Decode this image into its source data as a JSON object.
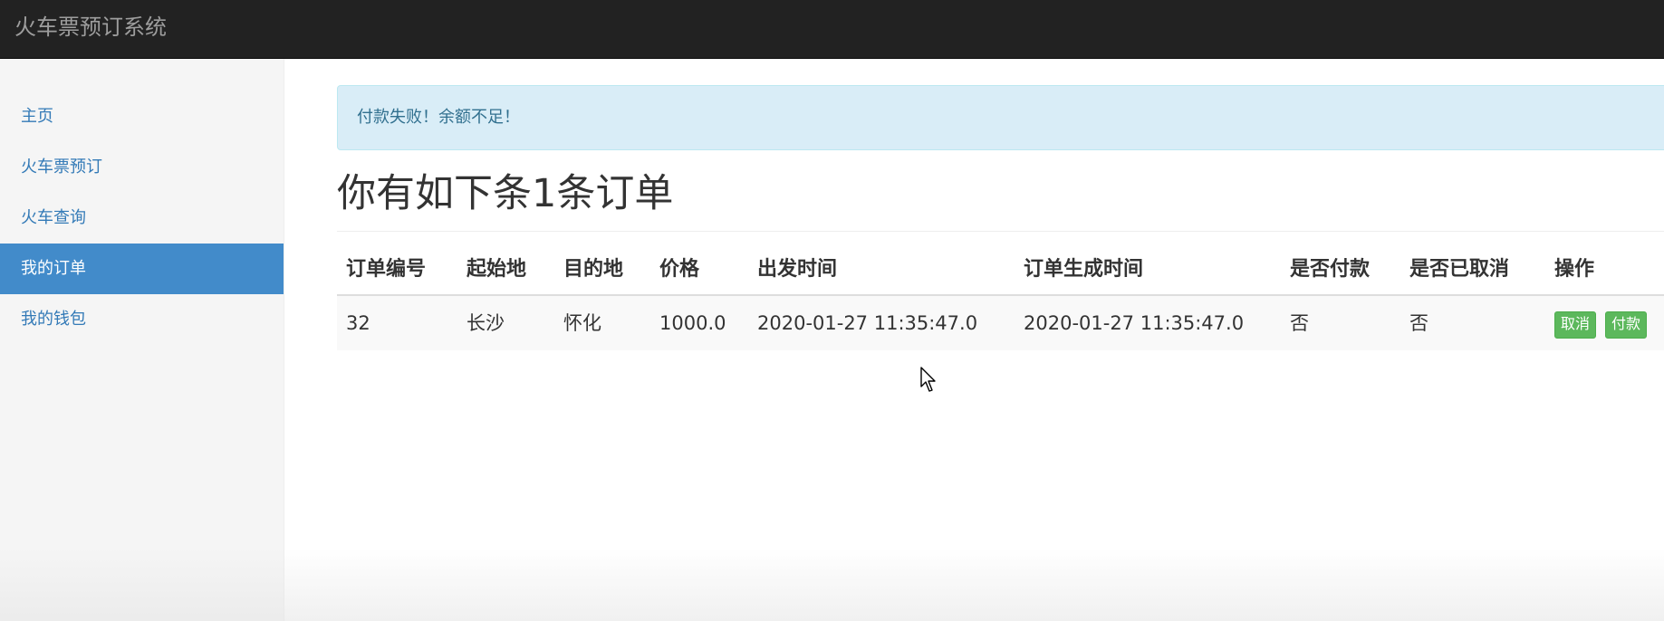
{
  "navbar": {
    "brand": "火车票预订系统"
  },
  "sidebar": {
    "items": [
      {
        "label": "主页",
        "active": false
      },
      {
        "label": "火车票预订",
        "active": false
      },
      {
        "label": "火车查询",
        "active": false
      },
      {
        "label": "我的订单",
        "active": true
      },
      {
        "label": "我的钱包",
        "active": false
      }
    ]
  },
  "main": {
    "alert": "付款失败！余额不足！",
    "title": "你有如下条1条订单",
    "table": {
      "headers": [
        "订单编号",
        "起始地",
        "目的地",
        "价格",
        "出发时间",
        "订单生成时间",
        "是否付款",
        "是否已取消",
        "操作"
      ],
      "rows": [
        {
          "id": "32",
          "from": "长沙",
          "to": "怀化",
          "price": "1000.0",
          "depart_time": "2020-01-27 11:35:47.0",
          "created_time": "2020-01-27 11:35:47.0",
          "paid": "否",
          "cancelled": "否",
          "actions": {
            "cancel": "取消",
            "pay": "付款"
          }
        }
      ]
    }
  },
  "icons": {
    "cursor": "mouse-pointer-icon"
  },
  "colors": {
    "navbar_bg": "#222222",
    "brand_text": "#9d9d9d",
    "sidebar_bg": "#f5f5f5",
    "link": "#337ab7",
    "active_bg": "#428bca",
    "alert_bg": "#d9edf7",
    "alert_text": "#31708f",
    "button_success": "#5cb85c"
  }
}
